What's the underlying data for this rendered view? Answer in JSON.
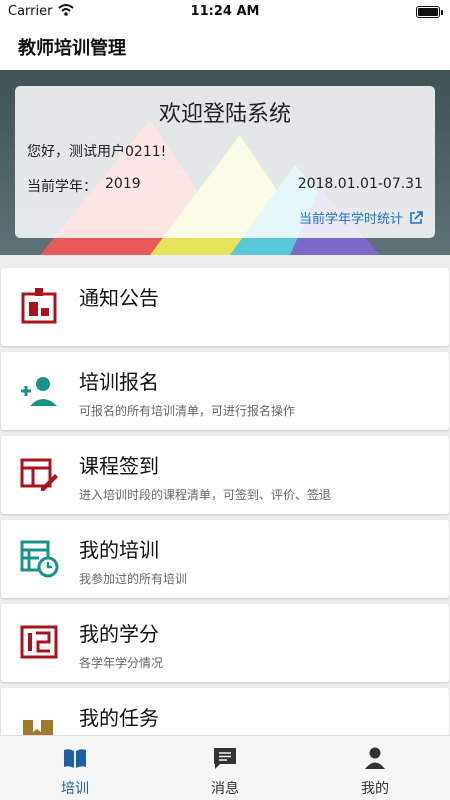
{
  "status_bar": {
    "carrier": "Carrier",
    "time": "11:24 AM"
  },
  "nav": {
    "title": "教师培训管理"
  },
  "welcome": {
    "title": "欢迎登陆系统",
    "greeting": "您好，测试用户0211!",
    "year_label": "当前学年：",
    "year_value": "2019",
    "date_range": "2018.01.01-07.31",
    "stats_link": "当前学年学时统计"
  },
  "menu": [
    {
      "title": "通知公告",
      "desc": "",
      "icon": "notice-board-icon",
      "color": "#a8141c"
    },
    {
      "title": "培训报名",
      "desc": "可报名的所有培训清单，可进行报名操作",
      "icon": "add-user-icon",
      "color": "#18938a"
    },
    {
      "title": "课程签到",
      "desc": "进入培训时段的课程清单，可签到、评价、签退",
      "icon": "course-signin-icon",
      "color": "#a8141c"
    },
    {
      "title": "我的培训",
      "desc": "我参加过的所有培训",
      "icon": "schedule-clock-icon",
      "color": "#18938a"
    },
    {
      "title": "我的学分",
      "desc": "各学年学分情况",
      "icon": "credits-icon",
      "color": "#a8141c"
    },
    {
      "title": "我的任务",
      "desc": "",
      "icon": "task-folder-icon",
      "color": "#a07a2a"
    }
  ],
  "tabs": [
    {
      "label": "培训",
      "icon": "book-icon",
      "active": true
    },
    {
      "label": "消息",
      "icon": "message-icon",
      "active": false
    },
    {
      "label": "我的",
      "icon": "person-icon",
      "active": false
    }
  ],
  "colors": {
    "accent": "#1f5fa8",
    "link": "#1f72c8",
    "red_icon": "#a8141c",
    "teal_icon": "#18938a"
  }
}
